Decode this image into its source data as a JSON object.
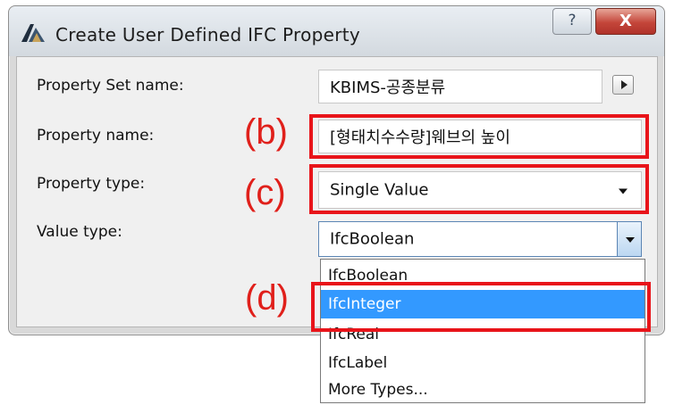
{
  "window": {
    "title": "Create User Defined IFC Property",
    "help_label": "?",
    "close_label": "X"
  },
  "form": {
    "property_set": {
      "label": "Property Set name:",
      "value": "KBIMS-공종분류"
    },
    "property_name": {
      "label": "Property name:",
      "value": "[형태치수수량]웨브의 높이"
    },
    "property_type": {
      "label": "Property type:",
      "value": "Single Value"
    },
    "value_type": {
      "label": "Value type:",
      "value": "IfcBoolean",
      "options": [
        "IfcBoolean",
        "IfcInteger",
        "IfcReal",
        "IfcLabel",
        "More Types..."
      ],
      "highlighted": "IfcInteger"
    }
  },
  "annotations": {
    "b": "(b)",
    "c": "(c)",
    "d": "(d)",
    "color": "#e8141a"
  },
  "colors": {
    "selection": "#3399ff",
    "close_button": "#c4463a"
  }
}
